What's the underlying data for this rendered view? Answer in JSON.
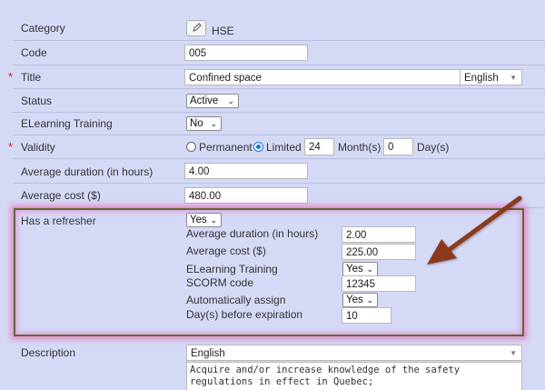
{
  "category": {
    "label": "Category",
    "value": "HSE"
  },
  "code": {
    "label": "Code",
    "value": "005"
  },
  "title": {
    "required_mark": "*",
    "label": "Title",
    "value": "Confined space",
    "language": "English"
  },
  "status": {
    "label": "Status",
    "value": "Active"
  },
  "elearning": {
    "label": "ELearning Training",
    "value": "No"
  },
  "validity": {
    "required_mark": "*",
    "label": "Validity",
    "permanent_label": "Permanent",
    "limited_label": "Limited",
    "selected": "Limited",
    "months_value": "24",
    "months_label": "Month(s)",
    "days_value": "0",
    "days_label": "Day(s)"
  },
  "avg_duration": {
    "label": "Average duration (in hours)",
    "value": "4.00"
  },
  "avg_cost": {
    "label": "Average cost ($)",
    "value": "480.00"
  },
  "refresher": {
    "label": "Has a refresher",
    "value": "Yes",
    "avg_duration_label": "Average duration (in hours)",
    "avg_duration_value": "2.00",
    "avg_cost_label": "Average cost ($)",
    "avg_cost_value": "225.00",
    "elearning_label": "ELearning Training",
    "elearning_value": "Yes",
    "scorm_label": "SCORM code",
    "scorm_value": "12345",
    "auto_assign_label": "Automatically assign",
    "auto_assign_value": "Yes",
    "days_before_label": "Day(s) before expiration",
    "days_before_value": "10"
  },
  "description": {
    "label": "Description",
    "language": "English",
    "text_line1": "Acquire and/or increase knowledge of the safety",
    "text_line2": "regulations in effect in Quebec;"
  },
  "colors": {
    "background": "#d4d9f6",
    "highlight_box": "#5e6a34",
    "glow": "#e878be",
    "arrow": "#8b3a1e",
    "required": "#d42020"
  },
  "icons": {
    "edit": "pencil-icon",
    "dropdown": "chevron-down-icon",
    "annotation": "arrow-annotation"
  }
}
